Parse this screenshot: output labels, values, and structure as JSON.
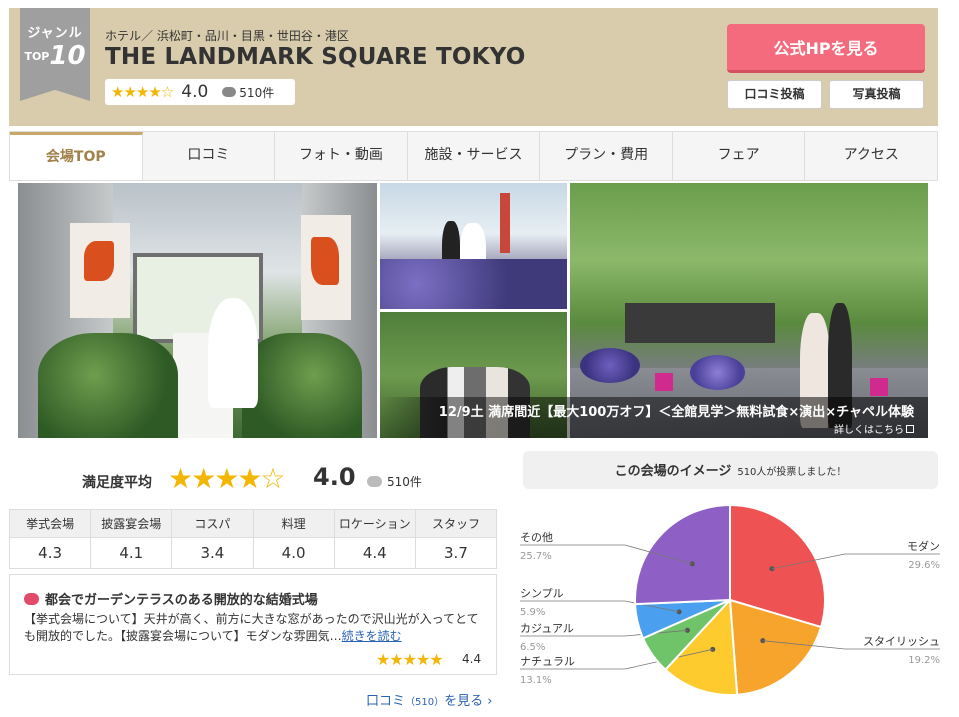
{
  "header": {
    "badge_line1": "ジャンル",
    "badge_top": "TOP",
    "badge_num": "10",
    "area": "ホテル／ 浜松町・品川・目黒・世田谷・港区",
    "title": "THE LANDMARK SQUARE TOKYO",
    "rating_stars": "★★★★☆",
    "rating": "4.0",
    "review_count": "510件",
    "official_button": "公式HPを見る",
    "post_review_button": "口コミ投稿",
    "post_photo_button": "写真投稿"
  },
  "tabs": [
    {
      "label": "会場TOP",
      "active": true
    },
    {
      "label": "口コミ",
      "active": false
    },
    {
      "label": "フォト・動画",
      "active": false
    },
    {
      "label": "施設・サービス",
      "active": false
    },
    {
      "label": "プラン・費用",
      "active": false
    },
    {
      "label": "フェア",
      "active": false
    },
    {
      "label": "アクセス",
      "active": false
    }
  ],
  "promo": {
    "text": "12/9土 満席間近【最大100万オフ】＜全館見学＞無料試食×演出×チャペル体験",
    "detail": "詳しくはこちら"
  },
  "satisfaction": {
    "title": "満足度平均",
    "stars_full": "★★★★",
    "stars_empty": "☆",
    "score": "4.0",
    "count": "510件",
    "categories": [
      {
        "label": "挙式会場",
        "value": "4.3"
      },
      {
        "label": "披露宴会場",
        "value": "4.1"
      },
      {
        "label": "コスパ",
        "value": "3.4"
      },
      {
        "label": "料理",
        "value": "4.0"
      },
      {
        "label": "ロケーション",
        "value": "4.4"
      },
      {
        "label": "スタッフ",
        "value": "3.7"
      }
    ]
  },
  "review": {
    "title": "都会でガーデンテラスのある開放的な結婚式場",
    "body": "【挙式会場について】天井が高く、前方に大きな窓があったので沢山光が入ってとても開放的でした。【披露宴会場について】モダンな雰囲気…",
    "link": "続きを読む",
    "stars": "★★★★★",
    "score": "4.4"
  },
  "more_link": {
    "label": "口コミ",
    "count": "（510）",
    "suffix": "を見る ›"
  },
  "image_chart": {
    "title": "この会場のイメージ",
    "votes": "510人が投票しました！"
  },
  "chart_data": {
    "type": "pie",
    "title": "この会場のイメージ",
    "categories": [
      "モダン",
      "スタイリッシュ",
      "ナチュラル",
      "カジュアル",
      "シンプル",
      "その他"
    ],
    "values": [
      29.6,
      19.2,
      13.1,
      6.5,
      5.9,
      25.7
    ],
    "labels": [
      "29.6%",
      "19.2%",
      "13.1%",
      "6.5%",
      "5.9%",
      "25.7%"
    ],
    "colors": [
      "#ee5253",
      "#f7a42c",
      "#fdcb2e",
      "#6fc46a",
      "#4aa0ef",
      "#8e5fc4"
    ]
  }
}
